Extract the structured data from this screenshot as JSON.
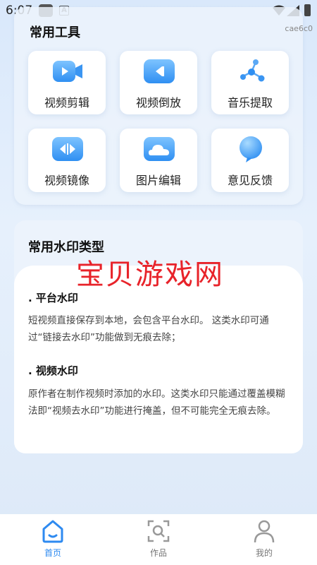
{
  "status_bar": {
    "time": "6:07",
    "device_id": "cae6c0"
  },
  "tools": {
    "title": "常用工具",
    "items": [
      {
        "label": "视频剪辑",
        "icon": "video-camera-icon"
      },
      {
        "label": "视频倒放",
        "icon": "video-reverse-icon"
      },
      {
        "label": "音乐提取",
        "icon": "molecule-icon"
      },
      {
        "label": "视频镜像",
        "icon": "video-mirror-icon"
      },
      {
        "label": "图片编辑",
        "icon": "cloud-image-icon"
      },
      {
        "label": "意见反馈",
        "icon": "bubble-icon"
      }
    ]
  },
  "watermark_info": {
    "title": "常用水印类型",
    "overlay": "宝贝游戏网",
    "sections": [
      {
        "heading": ". 平台水印",
        "text": "短视频直接保存到本地，会包含平台水印。 这类水印可通过“链接去水印”功能做到无痕去除；"
      },
      {
        "heading": ". 视频水印",
        "text": "原作者在制作视频时添加的水印。这类水印只能通过覆盖模糊法即“视频去水印”功能进行掩盖，但不可能完全无痕去除。"
      }
    ]
  },
  "bottom_nav": {
    "items": [
      {
        "label": "首页",
        "icon": "home-icon",
        "active": true
      },
      {
        "label": "作品",
        "icon": "works-icon",
        "active": false
      },
      {
        "label": "我的",
        "icon": "profile-icon",
        "active": false
      }
    ]
  },
  "colors": {
    "accent": "#2e8af0",
    "watermark_red": "#e8232a"
  }
}
